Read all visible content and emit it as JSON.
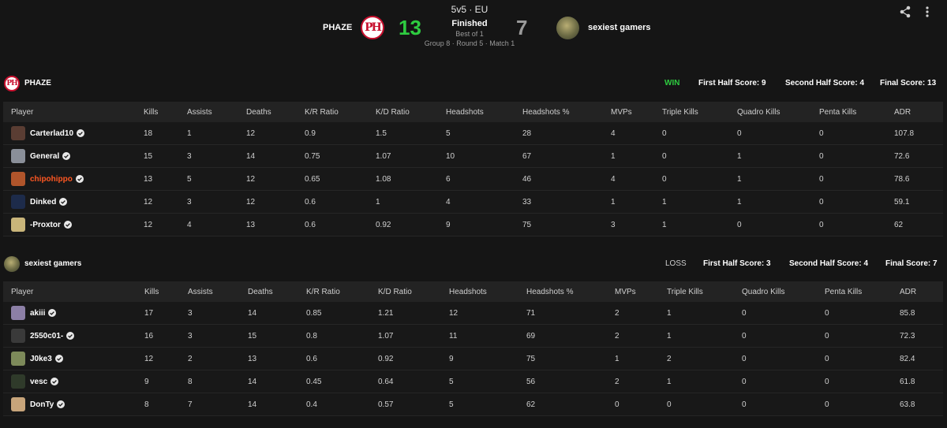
{
  "match": {
    "mode": "5v5 · EU",
    "status": "Finished",
    "best_of": "Best of 1",
    "meta": "Group 8 · Round 5 · Match 1",
    "team1": {
      "name": "PHAZE",
      "score": "13",
      "logo_text": "PH"
    },
    "team2": {
      "name": "sexiest gamers",
      "score": "7"
    }
  },
  "icons": {
    "share": "share-icon",
    "more": "more-vert-icon",
    "verified": "verified-check-icon"
  },
  "colors": {
    "win": "#2ecc40",
    "loss_score": "#9a9a9a",
    "highlight_player": "#ff5722",
    "background": "#151515"
  },
  "team1_stats": {
    "name": "PHAZE",
    "result": "WIN",
    "first_half": "First Half Score: 9",
    "second_half": "Second Half Score: 4",
    "final": "Final Score: 13",
    "columns": [
      "Player",
      "Kills",
      "Assists",
      "Deaths",
      "K/R Ratio",
      "K/D Ratio",
      "Headshots",
      "Headshots %",
      "MVPs",
      "Triple Kills",
      "Quadro Kills",
      "Penta Kills",
      "ADR"
    ],
    "players": [
      {
        "name": "Carterlad10",
        "stats": [
          "18",
          "1",
          "12",
          "0.9",
          "1.5",
          "5",
          "28",
          "4",
          "0",
          "0",
          "0",
          "107.8"
        ]
      },
      {
        "name": "General",
        "stats": [
          "15",
          "3",
          "14",
          "0.75",
          "1.07",
          "10",
          "67",
          "1",
          "0",
          "1",
          "0",
          "72.6"
        ]
      },
      {
        "name": "chipohippo",
        "stats": [
          "13",
          "5",
          "12",
          "0.65",
          "1.08",
          "6",
          "46",
          "4",
          "0",
          "1",
          "0",
          "78.6"
        ]
      },
      {
        "name": "Dinked",
        "stats": [
          "12",
          "3",
          "12",
          "0.6",
          "1",
          "4",
          "33",
          "1",
          "1",
          "1",
          "0",
          "59.1"
        ]
      },
      {
        "name": "-Proxtor",
        "stats": [
          "12",
          "4",
          "13",
          "0.6",
          "0.92",
          "9",
          "75",
          "3",
          "1",
          "0",
          "0",
          "62"
        ]
      }
    ]
  },
  "team2_stats": {
    "name": "sexiest gamers",
    "result": "LOSS",
    "first_half": "First Half Score: 3",
    "second_half": "Second Half Score: 4",
    "final": "Final Score: 7",
    "columns": [
      "Player",
      "Kills",
      "Assists",
      "Deaths",
      "K/R Ratio",
      "K/D Ratio",
      "Headshots",
      "Headshots %",
      "MVPs",
      "Triple Kills",
      "Quadro Kills",
      "Penta Kills",
      "ADR"
    ],
    "players": [
      {
        "name": "akiii",
        "stats": [
          "17",
          "3",
          "14",
          "0.85",
          "1.21",
          "12",
          "71",
          "2",
          "1",
          "0",
          "0",
          "85.8"
        ]
      },
      {
        "name": "2550c01-",
        "stats": [
          "16",
          "3",
          "15",
          "0.8",
          "1.07",
          "11",
          "69",
          "2",
          "1",
          "0",
          "0",
          "72.3"
        ]
      },
      {
        "name": "J0ke3",
        "stats": [
          "12",
          "2",
          "13",
          "0.6",
          "0.92",
          "9",
          "75",
          "1",
          "2",
          "0",
          "0",
          "82.4"
        ]
      },
      {
        "name": "vesc",
        "stats": [
          "9",
          "8",
          "14",
          "0.45",
          "0.64",
          "5",
          "56",
          "2",
          "1",
          "0",
          "0",
          "61.8"
        ]
      },
      {
        "name": "DonTy",
        "stats": [
          "8",
          "7",
          "14",
          "0.4",
          "0.57",
          "5",
          "62",
          "0",
          "0",
          "0",
          "0",
          "63.8"
        ]
      }
    ]
  }
}
